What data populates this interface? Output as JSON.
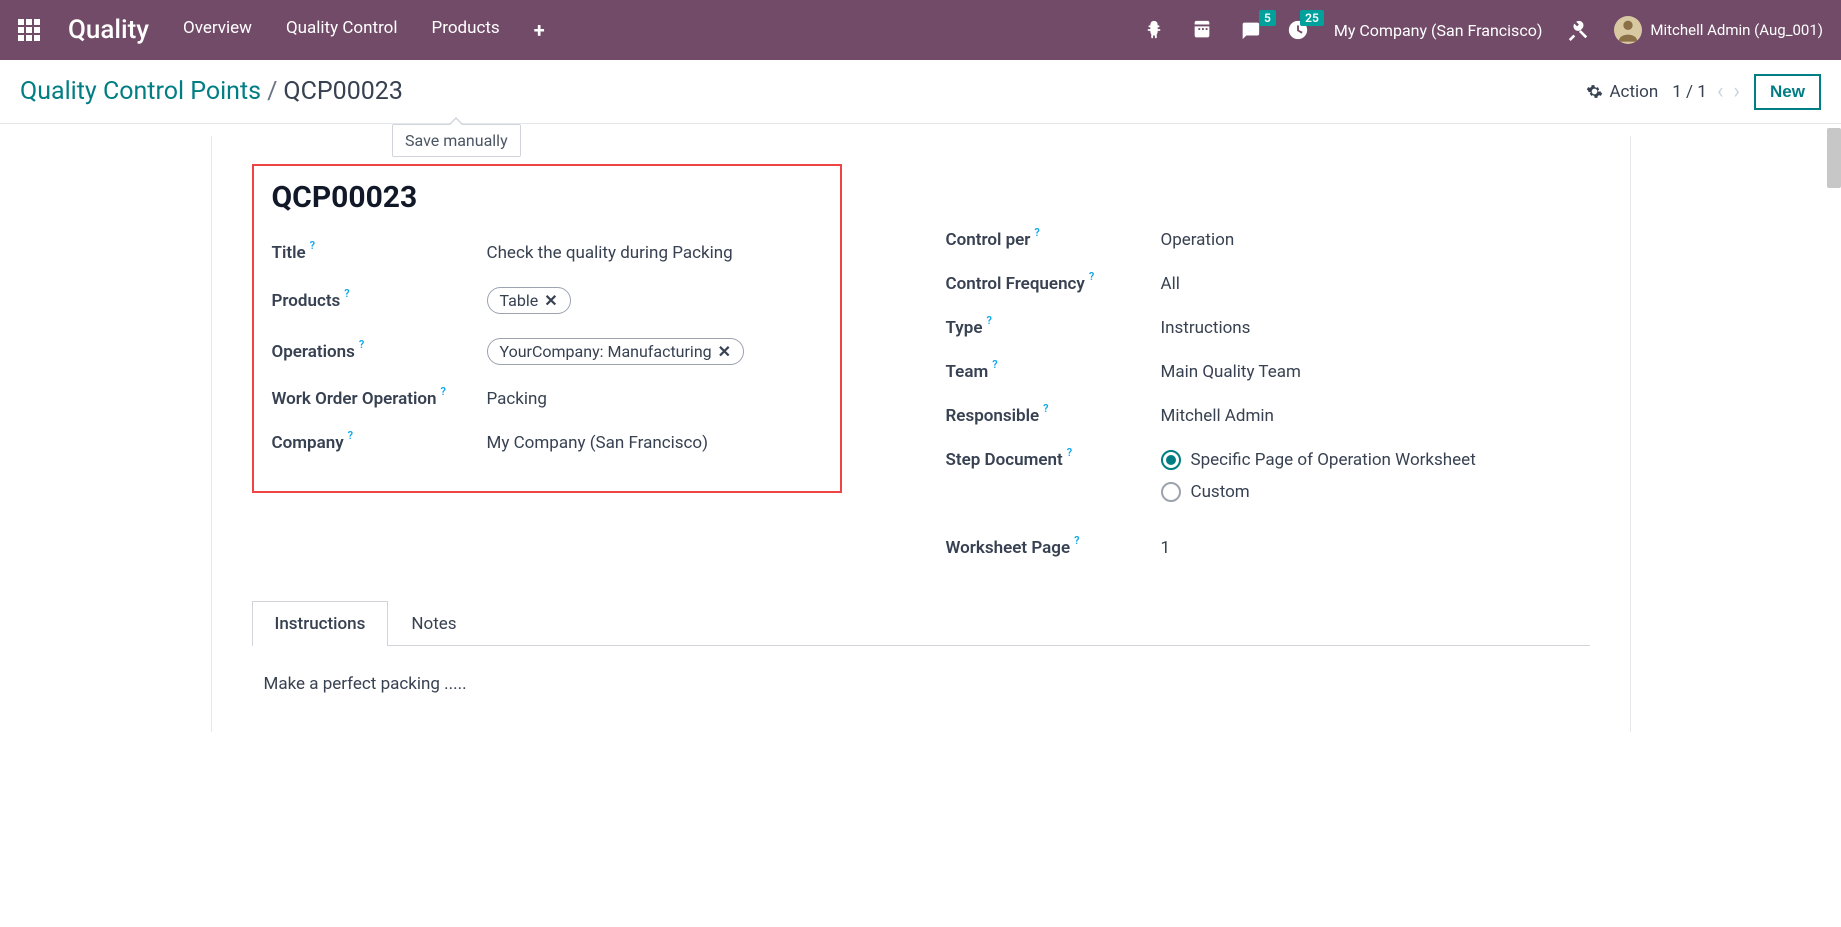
{
  "topbar": {
    "brand": "Quality",
    "nav": {
      "overview": "Overview",
      "qc": "Quality Control",
      "products": "Products"
    },
    "company": "My Company (San Francisco)",
    "user": "Mitchell Admin (Aug_001)",
    "badges": {
      "messages": "5",
      "activities": "25"
    }
  },
  "control": {
    "breadcrumb_root": "Quality Control Points",
    "breadcrumb_current": "QCP00023",
    "action": "Action",
    "pager": "1 / 1",
    "new": "New",
    "tooltip": "Save manually"
  },
  "form": {
    "name": "QCP00023",
    "labels": {
      "title": "Title",
      "products": "Products",
      "operations": "Operations",
      "wo_operation": "Work Order Operation",
      "company": "Company",
      "control_per": "Control per",
      "control_freq": "Control Frequency",
      "type": "Type",
      "team": "Team",
      "responsible": "Responsible",
      "step_doc": "Step Document",
      "ws_page": "Worksheet Page"
    },
    "values": {
      "title": "Check the quality during Packing",
      "product_tag": "Table",
      "operation_tag": "YourCompany: Manufacturing",
      "wo_operation": "Packing",
      "company": "My Company (San Francisco)",
      "control_per": "Operation",
      "control_freq": "All",
      "type": "Instructions",
      "team": "Main Quality Team",
      "responsible": "Mitchell Admin",
      "step_opt1": "Specific Page of Operation Worksheet",
      "step_opt2": "Custom",
      "ws_page": "1"
    },
    "tabs": {
      "instructions": "Instructions",
      "notes": "Notes"
    },
    "instructions_content": "Make a perfect packing ....."
  }
}
